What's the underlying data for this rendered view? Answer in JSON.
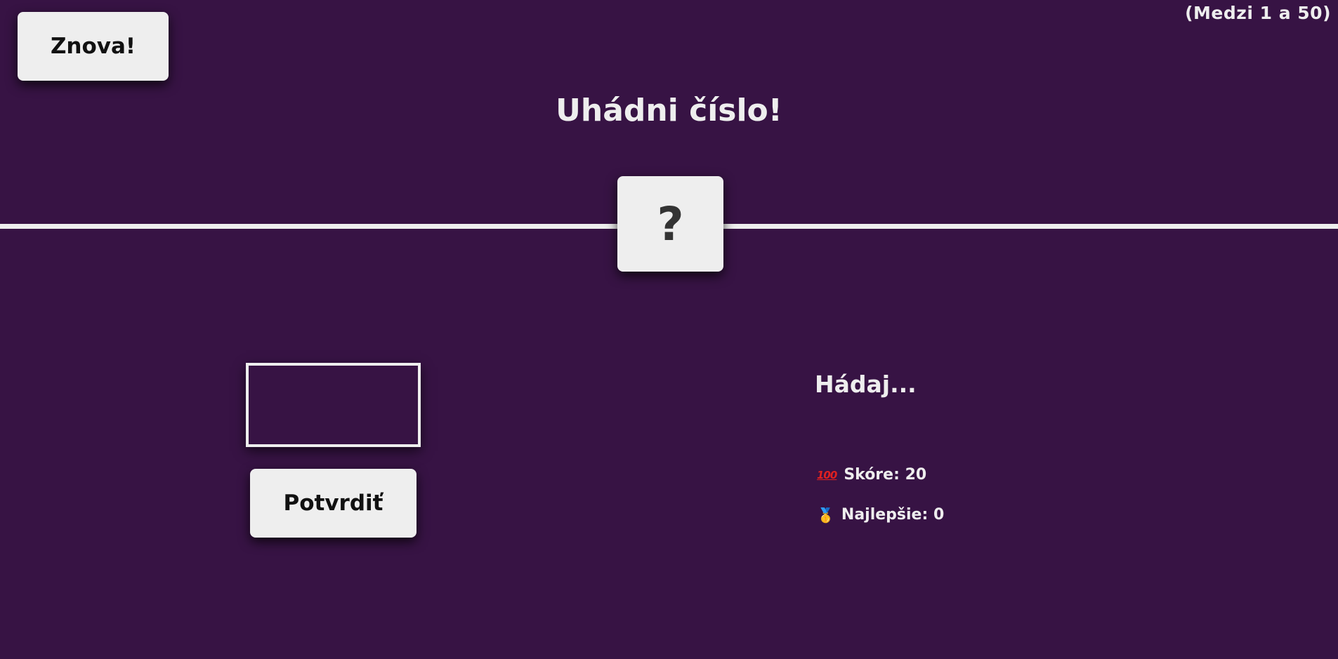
{
  "range_hint": "(Medzi 1 a 50)",
  "again_button": "Znova!",
  "title": "Uhádni číslo!",
  "secret_number": "?",
  "guess_input": {
    "value": "",
    "placeholder": ""
  },
  "check_button": "Potvrdiť",
  "message": "Hádaj...",
  "score": {
    "icon": "hundred-points-icon",
    "label": "Skóre:",
    "value": "20"
  },
  "highscore": {
    "icon": "medal-icon",
    "label": "Najlepšie:",
    "value": "0"
  },
  "colors": {
    "background": "#371344",
    "foreground": "#eeeeee"
  }
}
